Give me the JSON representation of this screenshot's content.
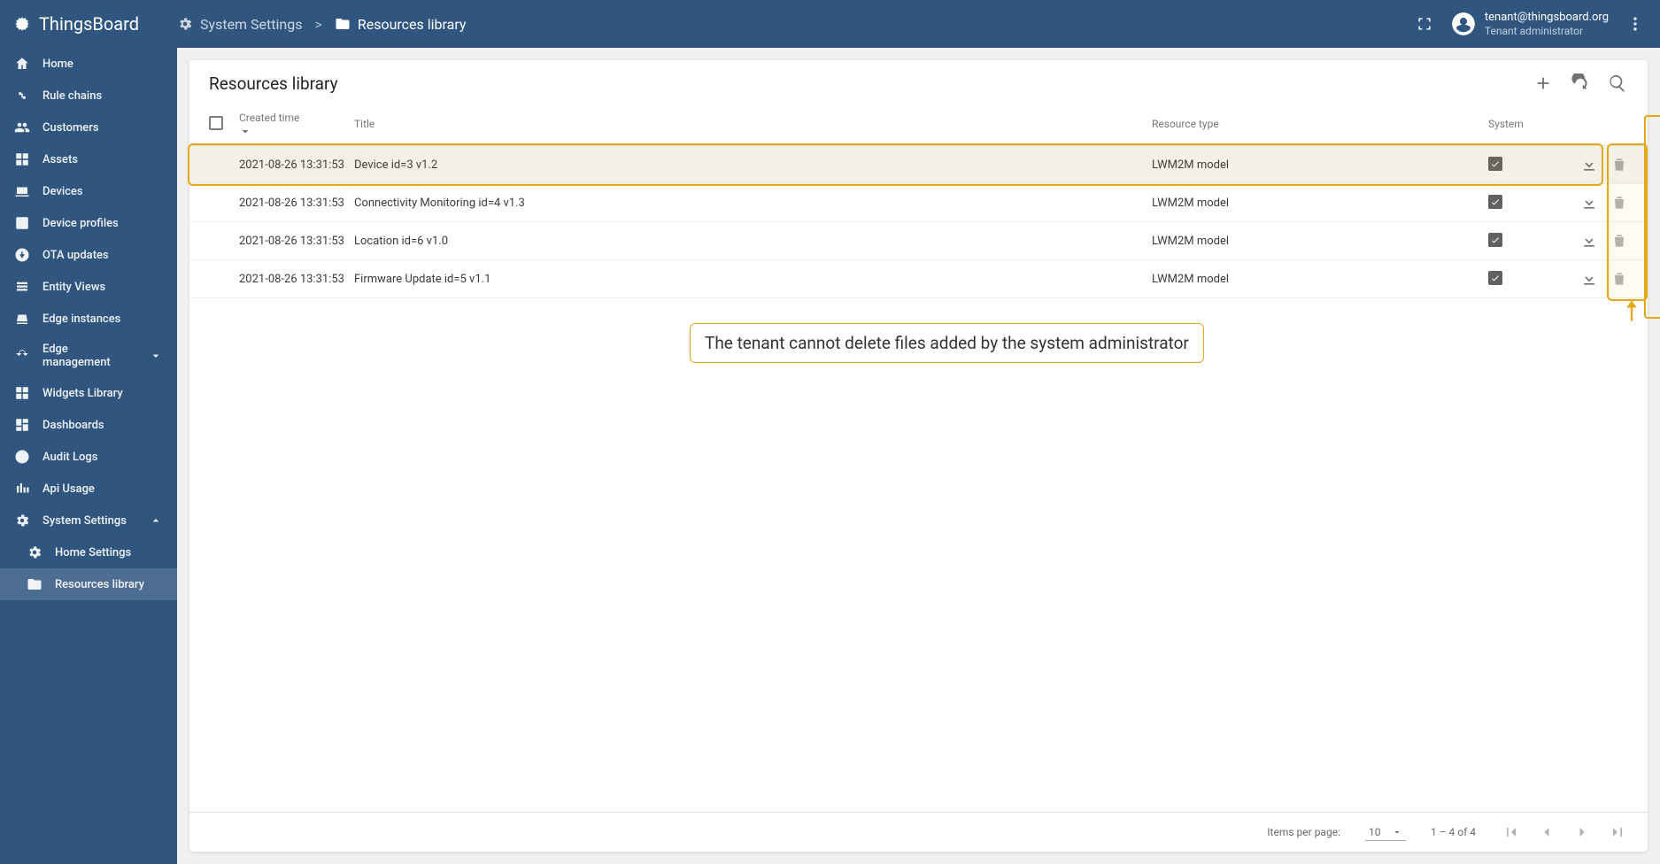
{
  "app": {
    "name": "ThingsBoard"
  },
  "breadcrumb": {
    "items": [
      {
        "label": "System Settings"
      },
      {
        "label": "Resources library"
      }
    ],
    "sep": ">"
  },
  "user": {
    "email": "tenant@thingsboard.org",
    "role": "Tenant administrator"
  },
  "sidebar": {
    "items": [
      {
        "label": "Home"
      },
      {
        "label": "Rule chains"
      },
      {
        "label": "Customers"
      },
      {
        "label": "Assets"
      },
      {
        "label": "Devices"
      },
      {
        "label": "Device profiles"
      },
      {
        "label": "OTA updates"
      },
      {
        "label": "Entity Views"
      },
      {
        "label": "Edge instances"
      },
      {
        "label": "Edge management"
      },
      {
        "label": "Widgets Library"
      },
      {
        "label": "Dashboards"
      },
      {
        "label": "Audit Logs"
      },
      {
        "label": "Api Usage"
      },
      {
        "label": "System Settings"
      },
      {
        "label": "Home Settings"
      },
      {
        "label": "Resources library"
      }
    ]
  },
  "page": {
    "title": "Resources library"
  },
  "table": {
    "columns": {
      "created": "Created time",
      "title": "Title",
      "type": "Resource type",
      "system": "System"
    },
    "rows": [
      {
        "created": "2021-08-26 13:31:53",
        "title": "Device id=3 v1.2",
        "type": "LWM2M model",
        "system": true
      },
      {
        "created": "2021-08-26 13:31:53",
        "title": "Connectivity Monitoring id=4 v1.3",
        "type": "LWM2M model",
        "system": true
      },
      {
        "created": "2021-08-26 13:31:53",
        "title": "Location id=6 v1.0",
        "type": "LWM2M model",
        "system": true
      },
      {
        "created": "2021-08-26 13:31:53",
        "title": "Firmware Update id=5 v1.1",
        "type": "LWM2M model",
        "system": true
      }
    ]
  },
  "paginator": {
    "items_per_page_label": "Items per page:",
    "page_size": "10",
    "range": "1 – 4 of 4"
  },
  "annotation": {
    "callout": "The tenant cannot delete files added by the system administrator"
  }
}
